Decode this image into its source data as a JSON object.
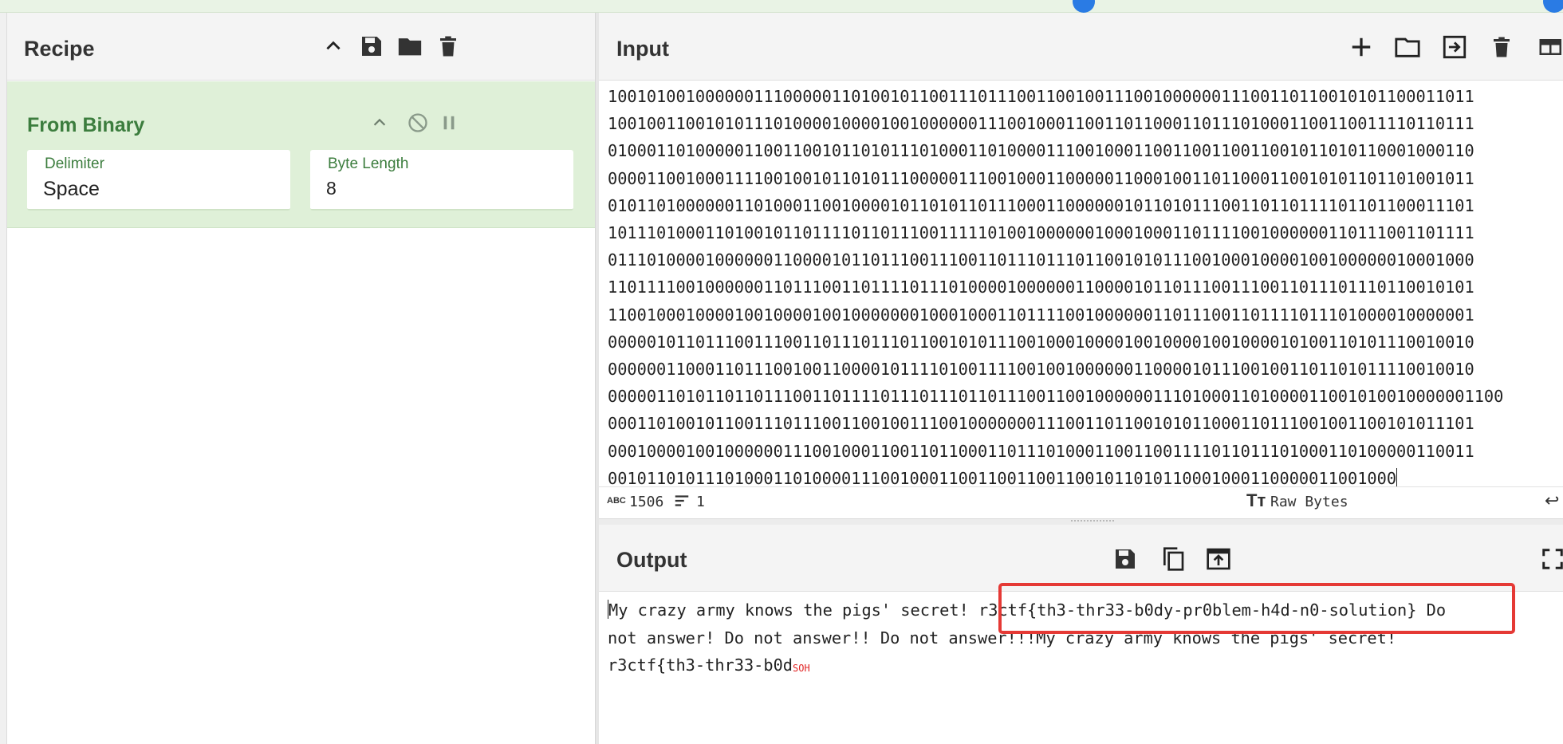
{
  "recipe": {
    "title": "Recipe",
    "operation": {
      "name": "From Binary",
      "fields": [
        {
          "label": "Delimiter",
          "value": "Space"
        },
        {
          "label": "Byte Length",
          "value": "8"
        }
      ]
    }
  },
  "input": {
    "title": "Input",
    "lines": [
      "10010100100000011100000110100101100111011100110010011100100000011100110110010101100011011",
      "10010011001010111010000100001001000000111001000110011011000110111010001100110011110110111",
      "01000110100000110011001011010111010001101000011100100011001100110011001011010110001000110",
      "00001100100011110010010110101110000011100100011000001100010011011000110010101101101001011",
      "01011010000001101000110010000101101011011100011000000101101011100110110111101101100011101",
      "10111010001101001011011110110111001111101001000000100010001101111001000000110111001101111",
      "01110100001000000110000101101110011100110111011101100101011100100010000100100000010001000",
      "11011110010000001101110011011110111010000100000011000010110111001110011011101110110010101",
      "11001000100001001000010010000000100010001101111001000000110111001101111011101000010000001",
      "00000101101110011100110111011101100101011100100010000100100001001000010100110101110010010",
      "00000011000110111001001100001011110100111100100100000011000010111001001101101011110010010",
      "00000110101101101110011011110111011101101110011001000000111010001101000011001010010000001100",
      "00011010010110011101110011001001110010000000111001101100101011000110111001001100101011101",
      "00010000100100000011100100011001101100011011101000110011001111011011101000110100000110011",
      "001011010111010001101000011100100011001100110011001011010110001000110000011001000"
    ],
    "status": {
      "length_icon": "abc-icon",
      "length": "1506",
      "lines_icon": "lines-icon",
      "lines": "1",
      "encoding_icon": "text-format-icon",
      "encoding": "Raw Bytes"
    }
  },
  "output": {
    "title": "Output",
    "lines": [
      "My crazy army knows the pigs' secret! r3ctf{th3-thr33-b0dy-pr0blem-h4d-n0-solution} Do",
      "not answer! Do not answer!! Do not answer!!!My crazy army knows the pigs' secret!",
      "r3ctf{th3-thr33-b0d"
    ],
    "control_char": "SOH"
  },
  "colors": {
    "accent_green": "#3c7d3e",
    "operation_bg": "#dff0d8",
    "highlight_red": "#e53935",
    "control_char_red": "#e02424"
  }
}
